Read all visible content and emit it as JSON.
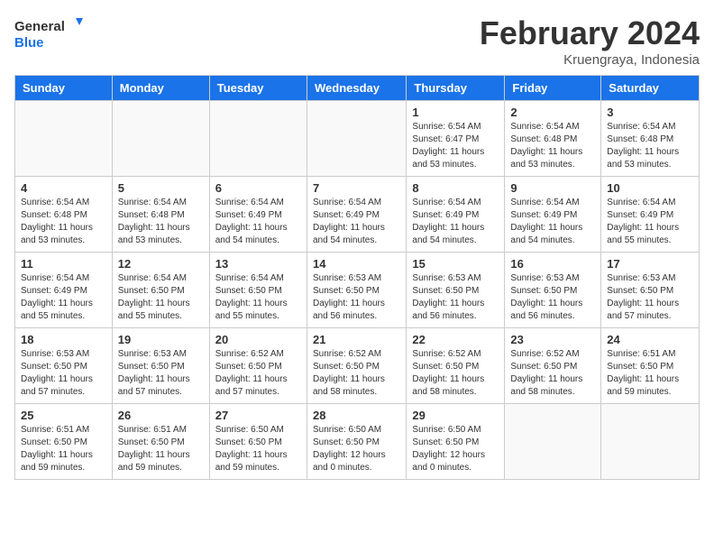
{
  "header": {
    "logo_line1": "General",
    "logo_line2": "Blue",
    "month_title": "February 2024",
    "location": "Kruengraya, Indonesia"
  },
  "weekdays": [
    "Sunday",
    "Monday",
    "Tuesday",
    "Wednesday",
    "Thursday",
    "Friday",
    "Saturday"
  ],
  "weeks": [
    [
      {
        "day": "",
        "info": ""
      },
      {
        "day": "",
        "info": ""
      },
      {
        "day": "",
        "info": ""
      },
      {
        "day": "",
        "info": ""
      },
      {
        "day": "1",
        "info": "Sunrise: 6:54 AM\nSunset: 6:47 PM\nDaylight: 11 hours\nand 53 minutes."
      },
      {
        "day": "2",
        "info": "Sunrise: 6:54 AM\nSunset: 6:48 PM\nDaylight: 11 hours\nand 53 minutes."
      },
      {
        "day": "3",
        "info": "Sunrise: 6:54 AM\nSunset: 6:48 PM\nDaylight: 11 hours\nand 53 minutes."
      }
    ],
    [
      {
        "day": "4",
        "info": "Sunrise: 6:54 AM\nSunset: 6:48 PM\nDaylight: 11 hours\nand 53 minutes."
      },
      {
        "day": "5",
        "info": "Sunrise: 6:54 AM\nSunset: 6:48 PM\nDaylight: 11 hours\nand 53 minutes."
      },
      {
        "day": "6",
        "info": "Sunrise: 6:54 AM\nSunset: 6:49 PM\nDaylight: 11 hours\nand 54 minutes."
      },
      {
        "day": "7",
        "info": "Sunrise: 6:54 AM\nSunset: 6:49 PM\nDaylight: 11 hours\nand 54 minutes."
      },
      {
        "day": "8",
        "info": "Sunrise: 6:54 AM\nSunset: 6:49 PM\nDaylight: 11 hours\nand 54 minutes."
      },
      {
        "day": "9",
        "info": "Sunrise: 6:54 AM\nSunset: 6:49 PM\nDaylight: 11 hours\nand 54 minutes."
      },
      {
        "day": "10",
        "info": "Sunrise: 6:54 AM\nSunset: 6:49 PM\nDaylight: 11 hours\nand 55 minutes."
      }
    ],
    [
      {
        "day": "11",
        "info": "Sunrise: 6:54 AM\nSunset: 6:49 PM\nDaylight: 11 hours\nand 55 minutes."
      },
      {
        "day": "12",
        "info": "Sunrise: 6:54 AM\nSunset: 6:50 PM\nDaylight: 11 hours\nand 55 minutes."
      },
      {
        "day": "13",
        "info": "Sunrise: 6:54 AM\nSunset: 6:50 PM\nDaylight: 11 hours\nand 55 minutes."
      },
      {
        "day": "14",
        "info": "Sunrise: 6:53 AM\nSunset: 6:50 PM\nDaylight: 11 hours\nand 56 minutes."
      },
      {
        "day": "15",
        "info": "Sunrise: 6:53 AM\nSunset: 6:50 PM\nDaylight: 11 hours\nand 56 minutes."
      },
      {
        "day": "16",
        "info": "Sunrise: 6:53 AM\nSunset: 6:50 PM\nDaylight: 11 hours\nand 56 minutes."
      },
      {
        "day": "17",
        "info": "Sunrise: 6:53 AM\nSunset: 6:50 PM\nDaylight: 11 hours\nand 57 minutes."
      }
    ],
    [
      {
        "day": "18",
        "info": "Sunrise: 6:53 AM\nSunset: 6:50 PM\nDaylight: 11 hours\nand 57 minutes."
      },
      {
        "day": "19",
        "info": "Sunrise: 6:53 AM\nSunset: 6:50 PM\nDaylight: 11 hours\nand 57 minutes."
      },
      {
        "day": "20",
        "info": "Sunrise: 6:52 AM\nSunset: 6:50 PM\nDaylight: 11 hours\nand 57 minutes."
      },
      {
        "day": "21",
        "info": "Sunrise: 6:52 AM\nSunset: 6:50 PM\nDaylight: 11 hours\nand 58 minutes."
      },
      {
        "day": "22",
        "info": "Sunrise: 6:52 AM\nSunset: 6:50 PM\nDaylight: 11 hours\nand 58 minutes."
      },
      {
        "day": "23",
        "info": "Sunrise: 6:52 AM\nSunset: 6:50 PM\nDaylight: 11 hours\nand 58 minutes."
      },
      {
        "day": "24",
        "info": "Sunrise: 6:51 AM\nSunset: 6:50 PM\nDaylight: 11 hours\nand 59 minutes."
      }
    ],
    [
      {
        "day": "25",
        "info": "Sunrise: 6:51 AM\nSunset: 6:50 PM\nDaylight: 11 hours\nand 59 minutes."
      },
      {
        "day": "26",
        "info": "Sunrise: 6:51 AM\nSunset: 6:50 PM\nDaylight: 11 hours\nand 59 minutes."
      },
      {
        "day": "27",
        "info": "Sunrise: 6:50 AM\nSunset: 6:50 PM\nDaylight: 11 hours\nand 59 minutes."
      },
      {
        "day": "28",
        "info": "Sunrise: 6:50 AM\nSunset: 6:50 PM\nDaylight: 12 hours\nand 0 minutes."
      },
      {
        "day": "29",
        "info": "Sunrise: 6:50 AM\nSunset: 6:50 PM\nDaylight: 12 hours\nand 0 minutes."
      },
      {
        "day": "",
        "info": ""
      },
      {
        "day": "",
        "info": ""
      }
    ]
  ]
}
